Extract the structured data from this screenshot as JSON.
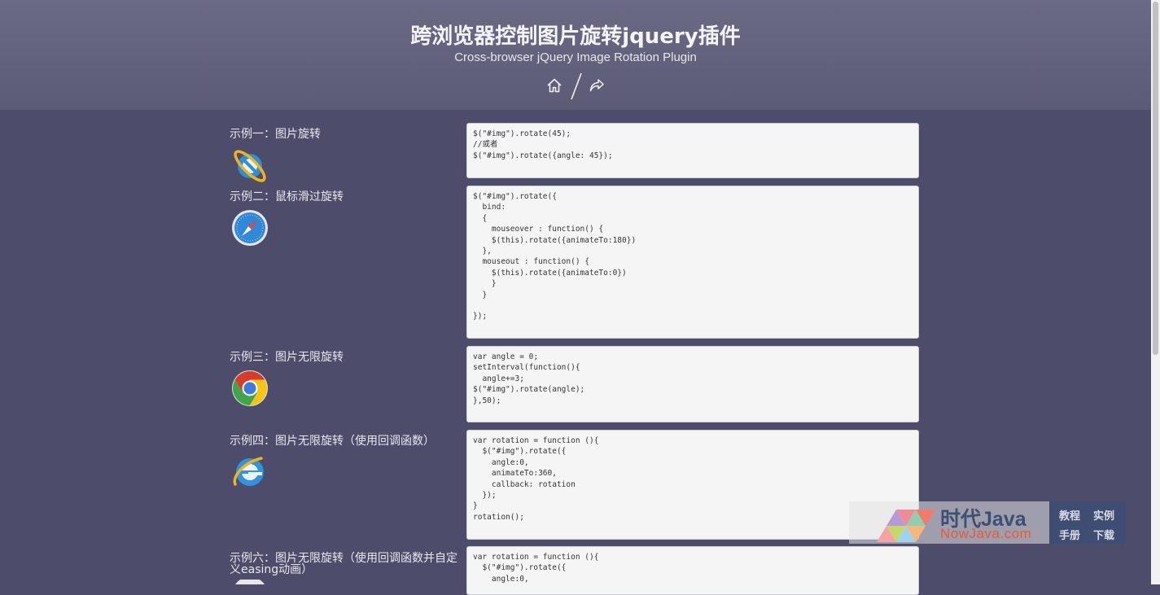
{
  "header": {
    "title": "跨浏览器控制图片旋转jquery插件",
    "subtitle": "Cross-browser jQuery Image Rotation Plugin",
    "nav_home_icon": "home-icon",
    "nav_share_icon": "share-arrow-icon"
  },
  "examples": [
    {
      "title": "示例一：图片旋转",
      "icon": "rotated-ie-logo-icon",
      "code": "$(\"#img\").rotate(45);\n//或者\n$(\"#img\").rotate({angle: 45});"
    },
    {
      "title": "示例二：鼠标滑过旋转",
      "icon": "safari-compass-icon",
      "code": "$(\"#img\").rotate({\n  bind:\n  {\n    mouseover : function() {\n    $(this).rotate({animateTo:180})\n  },\n  mouseout : function() {\n    $(this).rotate({animateTo:0})\n    }\n  }\n\n});"
    },
    {
      "title": "示例三：图片无限旋转",
      "icon": "chrome-logo-icon",
      "code": "var angle = 0;\nsetInterval(function(){\n  angle+=3;\n$(\"#img\").rotate(angle);\n},50);"
    },
    {
      "title": "示例四：图片无限旋转（使用回调函数）",
      "icon": "ie-logo-icon",
      "code": "var rotation = function (){\n  $(\"#img\").rotate({\n    angle:0,\n    animateTo:360,\n    callback: rotation\n  });\n}\nrotation();"
    },
    {
      "title": "示例六：图片无限旋转（使用回调函数并自定义easing动画）",
      "icon": "browser-logo-icon",
      "code": "var rotation = function (){\n  $(\"#img\").rotate({\n    angle:0,"
    }
  ],
  "watermark": {
    "brand": "时代Java",
    "domain": "NowJava.com",
    "links": [
      "教程",
      "实例",
      "手册",
      "下载"
    ]
  }
}
